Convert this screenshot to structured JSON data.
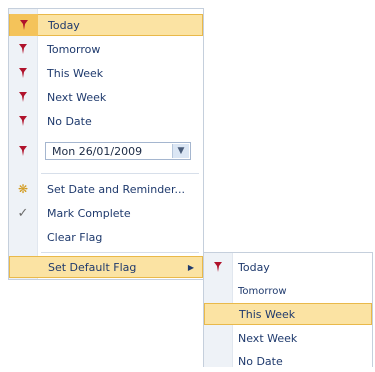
{
  "main_menu": {
    "items": [
      {
        "label": "Today",
        "icon": "red-flag-icon"
      },
      {
        "label": "Tomorrow",
        "icon": "red-flag-icon"
      },
      {
        "label": "This Week",
        "icon": "red-flag-icon"
      },
      {
        "label": "Next Week",
        "icon": "red-flag-icon"
      },
      {
        "label": "No Date",
        "icon": "red-flag-icon"
      }
    ],
    "date_picker": {
      "value": "Mon 26/01/2009",
      "icon": "red-flag-icon"
    },
    "actions": [
      {
        "label": "Set Date and Reminder...",
        "icon": "reminder-bell-icon"
      },
      {
        "label": "Mark Complete",
        "icon": "checkmark-icon"
      },
      {
        "label": "Clear Flag",
        "icon": ""
      }
    ],
    "default_flag": {
      "label": "Set Default Flag"
    }
  },
  "submenu": {
    "items": [
      {
        "label": "Today",
        "icon": "red-flag-icon"
      },
      {
        "label": "Tomorrow",
        "icon": ""
      },
      {
        "label": "This Week",
        "icon": ""
      },
      {
        "label": "Next Week",
        "icon": ""
      },
      {
        "label": "No Date",
        "icon": ""
      }
    ]
  },
  "colors": {
    "flag": "#b0122b",
    "highlight": "#fbe3a3",
    "highlight_border": "#e9b94a",
    "text": "#1f3a6d"
  }
}
